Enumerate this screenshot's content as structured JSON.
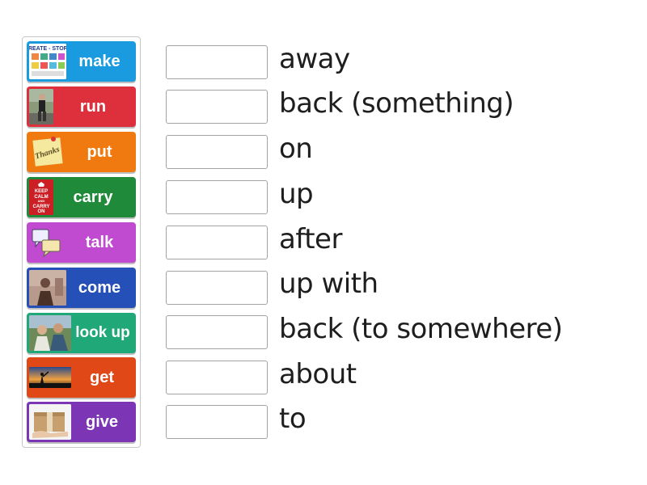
{
  "tiles": [
    {
      "label": "make",
      "color": "#1a9be0",
      "icon": "create-a-story-icon"
    },
    {
      "label": "run",
      "color": "#de2f3c",
      "icon": "runner-photo-icon"
    },
    {
      "label": "put",
      "color": "#f07a10",
      "icon": "thanks-note-icon"
    },
    {
      "label": "carry",
      "color": "#1f8a3a",
      "icon": "keep-calm-carry-on-icon"
    },
    {
      "label": "talk",
      "color": "#c04ad0",
      "icon": "speech-bubbles-icon"
    },
    {
      "label": "come",
      "color": "#2550b8",
      "icon": "portrait-photo-icon"
    },
    {
      "label": "look up",
      "color": "#20a878",
      "icon": "men-looking-up-photo-icon"
    },
    {
      "label": "get",
      "color": "#e04818",
      "icon": "sunset-silhouette-photo-icon"
    },
    {
      "label": "give",
      "color": "#7b35b5",
      "icon": "box-handover-icon"
    }
  ],
  "phrases": [
    "away",
    "back (something)",
    "on",
    "up",
    "after",
    "up with",
    "back (to somewhere)",
    "about",
    "to"
  ],
  "tile_thumbnail_text": {
    "make": "CREATE - STORY",
    "put": "Thanks",
    "carry": "KEEP CALM AND CARRY ON"
  }
}
